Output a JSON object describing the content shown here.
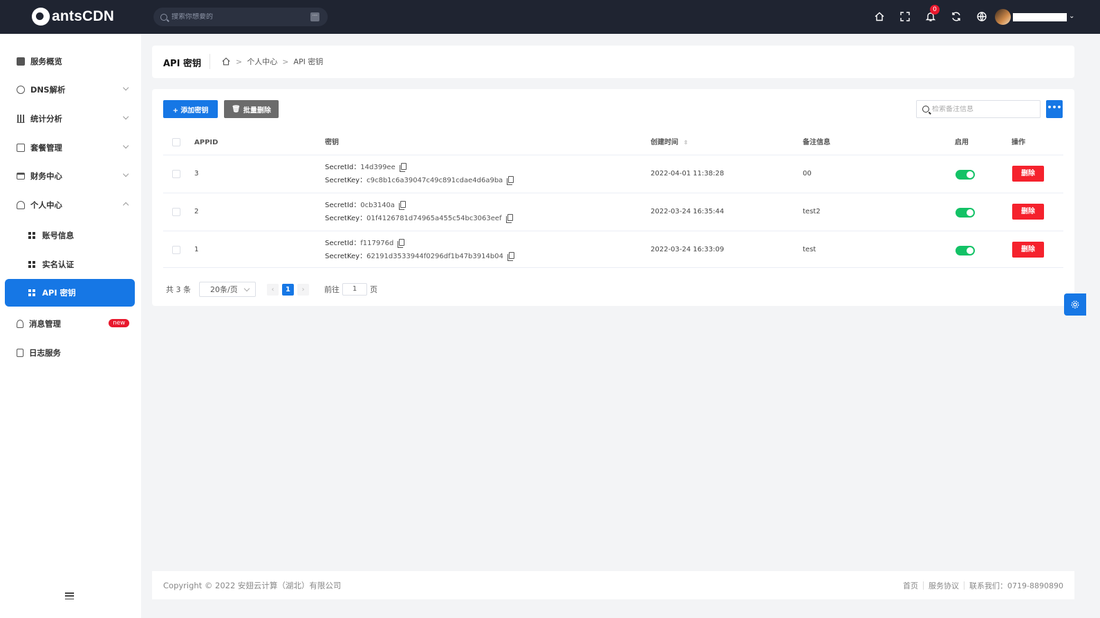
{
  "app": {
    "brand": "antsCDN"
  },
  "topbar": {
    "search_placeholder": "搜索你想要的",
    "notifications_count": "0",
    "icons": [
      "home-icon",
      "fullscreen-icon",
      "bell-icon",
      "refresh-icon",
      "globe-icon"
    ]
  },
  "sidebar": {
    "items": [
      {
        "label": "服务概览",
        "icon": "overview-icon"
      },
      {
        "label": "DNS解析",
        "icon": "globe-icon"
      },
      {
        "label": "统计分析",
        "icon": "bar-chart-icon"
      },
      {
        "label": "套餐管理",
        "icon": "package-icon"
      },
      {
        "label": "财务中心",
        "icon": "card-icon"
      },
      {
        "label": "个人中心",
        "icon": "user-icon"
      },
      {
        "label": "账号信息",
        "icon": "grid-icon"
      },
      {
        "label": "实名认证",
        "icon": "grid-icon"
      },
      {
        "label": "API 密钥",
        "icon": "grid-icon",
        "active": true
      },
      {
        "label": "消息管理",
        "icon": "bell-icon",
        "badge": "new"
      },
      {
        "label": "日志服务",
        "icon": "file-icon"
      }
    ]
  },
  "header": {
    "title": "API 密钥",
    "breadcrumb": [
      "个人中心",
      "API 密钥"
    ]
  },
  "toolbar": {
    "add_label": "+ 添加密钥",
    "batch_delete_label": "批量删除",
    "search_placeholder": "检索备注信息",
    "more_label": "•••"
  },
  "table": {
    "columns": [
      "APPID",
      "密钥",
      "创建时间",
      "备注信息",
      "启用",
      "操作"
    ],
    "secret_id_label": "SecretId：",
    "secret_key_label": "SecretKey：",
    "delete_label": "删除",
    "rows": [
      {
        "appid": "3",
        "secret_id": "14d399ee",
        "secret_key": "c9c8b1c6a39047c49c891cdae4d6a9ba",
        "created": "2022-04-01 11:38:28",
        "note": "00",
        "enabled": true
      },
      {
        "appid": "2",
        "secret_id": "0cb3140a",
        "secret_key": "01f4126781d74965a455c54bc3063eef",
        "created": "2022-03-24 16:35:44",
        "note": "test2",
        "enabled": true
      },
      {
        "appid": "1",
        "secret_id": "f117976d",
        "secret_key": "62191d3533944f0296df1b47b3914b04",
        "created": "2022-03-24 16:33:09",
        "note": "test",
        "enabled": true
      }
    ]
  },
  "pagination": {
    "total": "共 3 条",
    "page_size": "20条/页",
    "current_page": "1",
    "goto_label": "前往",
    "goto_value": "1",
    "page_suffix": "页"
  },
  "footer": {
    "copyright": "Copyright © 2022 安翅云计算（湖北）有限公司",
    "links": [
      "首页",
      "服务协议",
      "联系我们：0719-8890890"
    ]
  },
  "colors": {
    "primary": "#1677e5",
    "danger": "#f5222d",
    "success": "#13c266",
    "topbar": "#1f2431"
  }
}
